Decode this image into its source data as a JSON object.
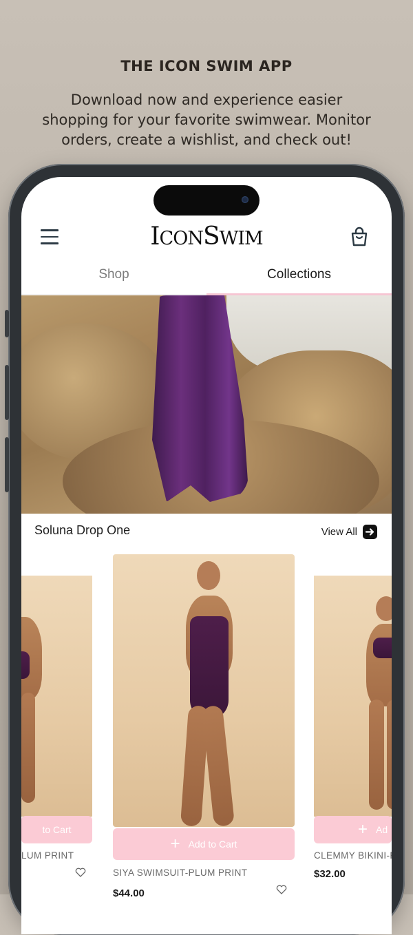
{
  "promo": {
    "title": "THE ICON SWIM APP",
    "subtitle": "Download now and experience easier shopping for your favorite swimwear. Monitor orders, create a wishlist, and check out!"
  },
  "app": {
    "logo_main": "ICONSWIM",
    "tabs": [
      {
        "label": "Shop",
        "active": false
      },
      {
        "label": "Collections",
        "active": true
      }
    ],
    "icons": {
      "menu": "hamburger-menu-icon",
      "bag": "shopping-bag-icon",
      "view_all_arrow": "arrow-right-icon",
      "wishlist": "heart-icon"
    },
    "collection": {
      "title": "Soluna Drop One",
      "view_all_label": "View All"
    },
    "products": [
      {
        "name_visible": "LUM PRINT",
        "add_to_cart_visible": "to Cart"
      },
      {
        "name": "SIYA SWIMSUIT-PLUM PRINT",
        "price": "$44.00",
        "add_to_cart": "Add to Cart"
      },
      {
        "name_visible": "CLEMMY BIKINI-PL",
        "price": "$32.00",
        "add_to_cart_visible": "Ad"
      }
    ],
    "colors": {
      "accent_pink": "#fbcbd5",
      "tab_underline": "#f7c6d3",
      "text_dark": "#1b1b1b",
      "text_muted": "#7c7c7c"
    }
  }
}
